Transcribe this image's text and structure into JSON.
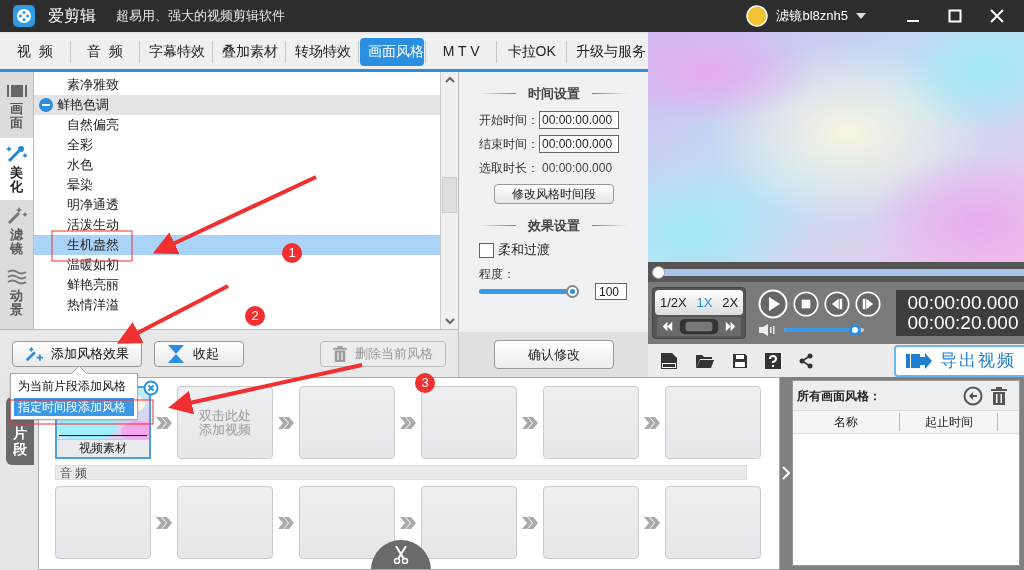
{
  "app": {
    "name": "爱剪辑",
    "slogan": "超易用、强大的视频剪辑软件",
    "user": "滤镜bl8znh5"
  },
  "tabs": [
    {
      "label": "视  频",
      "selected": false
    },
    {
      "label": "音  频",
      "selected": false
    },
    {
      "label": "字幕特效",
      "selected": false
    },
    {
      "label": "叠加素材",
      "selected": false
    },
    {
      "label": "转场特效",
      "selected": false
    },
    {
      "label": "画面风格",
      "selected": true
    },
    {
      "label": "M T V",
      "selected": false
    },
    {
      "label": "卡拉OK",
      "selected": false
    },
    {
      "label": "升级与服务",
      "selected": false
    }
  ],
  "side_tabs": [
    {
      "label": "画面",
      "selected": false
    },
    {
      "label": "美化",
      "selected": true
    },
    {
      "label": "滤镜",
      "selected": false
    },
    {
      "label": "动景",
      "selected": false
    }
  ],
  "style_list": [
    {
      "label": "素净雅致",
      "selected": false
    },
    {
      "label": "鲜艳色调",
      "selected": false,
      "expanded": true,
      "children": [
        {
          "label": "自然偏亮",
          "selected": false
        },
        {
          "label": "全彩",
          "selected": false
        },
        {
          "label": "水色",
          "selected": false
        },
        {
          "label": "晕染",
          "selected": false
        },
        {
          "label": "明净通透",
          "selected": false
        },
        {
          "label": "活泼生动",
          "selected": false
        },
        {
          "label": "生机盎然",
          "selected": true
        },
        {
          "label": "温暖如初",
          "selected": false
        },
        {
          "label": "鲜艳亮丽",
          "selected": false
        },
        {
          "label": "热情洋溢",
          "selected": false
        }
      ]
    }
  ],
  "list_buttons": [
    {
      "kind": "add",
      "label": "添加风格效果",
      "disabled": false
    },
    {
      "kind": "collapse",
      "label": "收起",
      "disabled": false
    },
    {
      "kind": "delete",
      "label": "删除当前风格",
      "disabled": true
    }
  ],
  "time_settings": {
    "title": "时间设置",
    "start_label": "开始时间：",
    "start": "00:00:00.000",
    "end_label": "结束时间：",
    "end": "00:00:00.000",
    "duration_label": "选取时长：",
    "duration": "00:00:00.000",
    "button": "修改风格时间段"
  },
  "effect_settings": {
    "title": "效果设置",
    "soft_transition": {
      "label": "柔和过渡",
      "checked": false
    },
    "degree_label": "程度：",
    "degree": {
      "level": 1,
      "value": "100"
    },
    "confirm": "确认修改"
  },
  "preview": {
    "kind": "picture",
    "seek": {
      "level": 0
    }
  },
  "playback": {
    "speeds": [
      {
        "label": "1/2X",
        "selected": false
      },
      {
        "label": "1X",
        "selected": true
      },
      {
        "label": "2X",
        "selected": false
      }
    ],
    "current_time": "00:00:00.000",
    "total_time": "00:00:20.000",
    "volume": {
      "level": 0.95
    }
  },
  "export_button": "导出视频",
  "context_menu": [
    {
      "label": "为当前片段添加风格",
      "selected": false
    },
    {
      "label": "指定时间段添加风格",
      "selected": true
    }
  ],
  "timeline": {
    "tab": "片段",
    "video_clips": [
      {
        "kind": "clip",
        "label": "视频素材",
        "selected": true
      },
      {
        "kind": "placeholder",
        "label": "双击此处添加视频"
      },
      {
        "kind": "empty"
      },
      {
        "kind": "empty"
      },
      {
        "kind": "empty"
      },
      {
        "kind": "empty"
      }
    ],
    "audio_label": "音 频",
    "audio_clips": [
      {
        "kind": "empty"
      },
      {
        "kind": "empty"
      },
      {
        "kind": "empty"
      },
      {
        "kind": "empty"
      },
      {
        "kind": "empty"
      },
      {
        "kind": "empty"
      }
    ]
  },
  "styles_panel": {
    "title": "所有画面风格：",
    "columns": [
      "名称",
      "起止时间"
    ]
  },
  "annotations": [
    {
      "number": "1"
    },
    {
      "number": "2"
    },
    {
      "number": "3"
    }
  ]
}
